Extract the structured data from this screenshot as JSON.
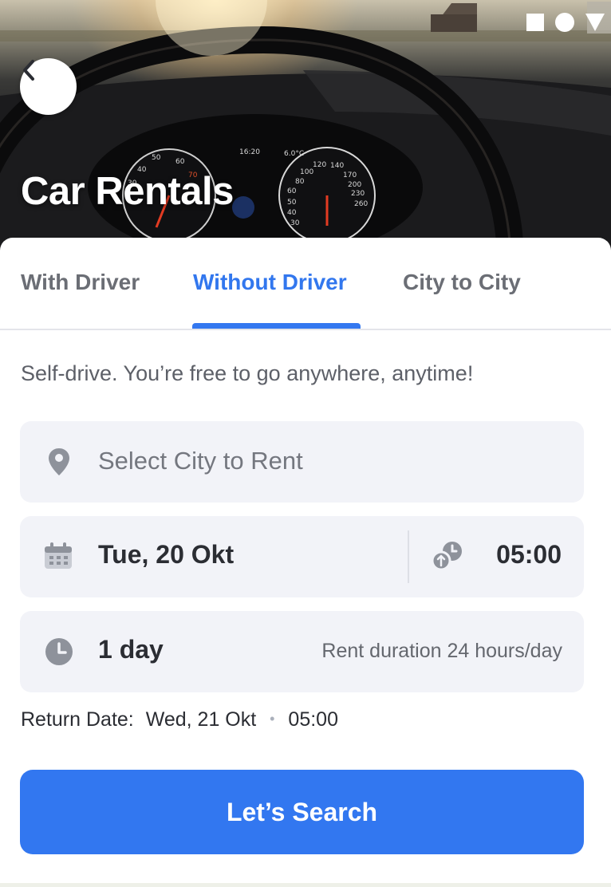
{
  "header": {
    "title": "Car Rentals",
    "back_icon": "chevron-left-icon"
  },
  "status_bar": {
    "icons": [
      "square-icon",
      "circle-icon",
      "triangle-down-icon"
    ]
  },
  "tabs": [
    {
      "label": "With Driver",
      "active": false
    },
    {
      "label": "Without Driver",
      "active": true
    },
    {
      "label": "City to City",
      "active": false
    }
  ],
  "subtitle": "Self-drive. You’re free to go anywhere, anytime!",
  "city_field": {
    "icon": "location-pin-icon",
    "placeholder": "Select City to Rent"
  },
  "date_field": {
    "icon": "calendar-icon",
    "date": "Tue, 20 Okt",
    "time_icon": "pickup-time-icon",
    "time": "05:00"
  },
  "duration_field": {
    "icon": "clock-icon",
    "value": "1 day",
    "note": "Rent duration 24 hours/day"
  },
  "return": {
    "label": "Return Date:",
    "date": "Wed, 21 Okt",
    "separator": "•",
    "time": "05:00"
  },
  "search_button": {
    "label": "Let’s Search"
  },
  "colors": {
    "accent": "#3277ee",
    "field_bg": "#f2f3f8",
    "text_dark": "#2b2d33",
    "text_muted": "#6b6e75"
  }
}
